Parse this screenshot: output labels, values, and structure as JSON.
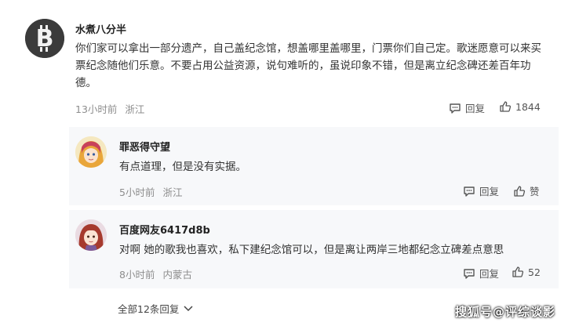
{
  "comments": [
    {
      "username": "水煮八分半",
      "text": "你们家可以拿出一部分遗产，自己盖纪念馆，想盖哪里盖哪里，门票你们自己定。歌迷愿意可以来买票纪念随他们乐意。不要占用公益资源，说句难听的，虽说印象不错，但是离立纪念碑还差百年功德。",
      "time": "13小时前",
      "location": "浙江",
      "reply_label": "回复",
      "like_label": "1844"
    }
  ],
  "replies": [
    {
      "username": "罪恶得守望",
      "text": "有点道理，但是没有实据。",
      "time": "5小时前",
      "location": "浙江",
      "reply_label": "回复",
      "like_label": "赞"
    },
    {
      "username": "百度网友6417d8b",
      "text": "对啊 她的歌我也喜欢，私下建纪念馆可以，但是离让两岸三地都纪念立碑差点意思",
      "time": "8小时前",
      "location": "内蒙古",
      "reply_label": "回复",
      "like_label": "52"
    }
  ],
  "expand_label": "全部12条回复",
  "watermark": "搜狐号@评综谈影",
  "icons": {
    "reply": "comment-bubble-icon",
    "like": "thumbs-up-icon",
    "expand": "chevron-down-icon"
  }
}
